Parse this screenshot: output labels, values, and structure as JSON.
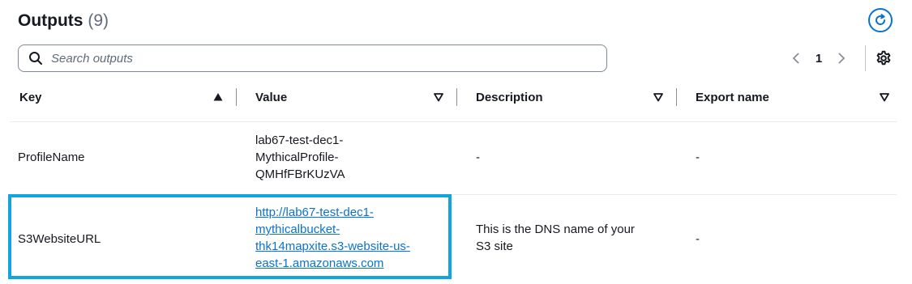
{
  "header": {
    "title": "Outputs",
    "count": "(9)"
  },
  "search": {
    "placeholder": "Search outputs"
  },
  "pagination": {
    "current_page": "1"
  },
  "table": {
    "columns": [
      {
        "label": "Key",
        "sort": "ascending"
      },
      {
        "label": "Value",
        "sort": "none"
      },
      {
        "label": "Description",
        "sort": "none"
      },
      {
        "label": "Export name",
        "sort": "none"
      }
    ],
    "rows": [
      {
        "key": "ProfileName",
        "value_lines": [
          "lab67-test-dec1-",
          "MythicalProfile-",
          "QMHfFBrKUzVA"
        ],
        "value_is_link": false,
        "description_lines": [
          "-"
        ],
        "export_name": "-"
      },
      {
        "key": "S3WebsiteURL",
        "value_lines": [
          "http://lab67-test-dec1-",
          "mythicalbucket-",
          "thk14mapxite.s3-website-us-",
          "east-1.amazonaws.com"
        ],
        "value_is_link": true,
        "description_lines": [
          "This is the DNS name of your",
          "S3 site"
        ],
        "export_name": "-"
      }
    ]
  },
  "colors": {
    "accent": "#0972d3",
    "highlight": "#10a4e0",
    "text": "#16191f",
    "muted": "#5f6b7a"
  }
}
